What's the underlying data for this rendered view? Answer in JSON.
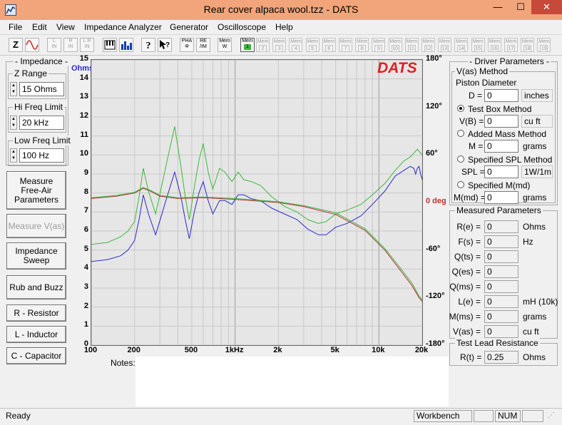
{
  "window": {
    "title": "Rear cover alpaca wool.tzz - DATS",
    "min": "—",
    "max": "☐",
    "close": "✕"
  },
  "menu": [
    "File",
    "Edit",
    "View",
    "Impedance Analyzer",
    "Generator",
    "Oscilloscope",
    "Help"
  ],
  "toolbar": {
    "z": "Z",
    "l_in": [
      "L",
      "IN"
    ],
    "r_in": [
      "R",
      "IN"
    ],
    "lr_in": [
      "L R",
      "IN"
    ],
    "pha": [
      "PHA",
      "Φ"
    ],
    "re_im": [
      "RE",
      "/IM"
    ],
    "mem_w": [
      "Mem",
      "W"
    ],
    "mem1": [
      "Mem",
      "1"
    ],
    "mem_slots": [
      "2",
      "3",
      "4",
      "5",
      "6",
      "7",
      "8",
      "9",
      "10",
      "11",
      "12",
      "13",
      "14",
      "15",
      "16",
      "17",
      "18",
      "19"
    ],
    "mem_label": "Mem"
  },
  "left": {
    "impedance_group": "Impedance",
    "z_range_label": "Z Range",
    "z_range_value": "15 Ohms",
    "hi_freq_label": "Hi Freq Limit",
    "hi_freq_value": "20 kHz",
    "low_freq_label": "Low Freq Limit",
    "low_freq_value": "100 Hz",
    "btn_measure_free_air": "Measure Free-Air Parameters",
    "btn_measure_vas": "Measure V(as)",
    "btn_impedance_sweep": "Impedance Sweep",
    "btn_rub_buzz": "Rub and Buzz",
    "btn_r": "R - Resistor",
    "btn_l": "L - Inductor",
    "btn_c": "C - Capacitor"
  },
  "graph": {
    "logo": "DATS",
    "y_unit": "Ohms",
    "y_ticks": [
      "15",
      "14",
      "13",
      "12",
      "11",
      "10",
      "9",
      "8",
      "7",
      "6",
      "5",
      "4",
      "3",
      "2",
      "1",
      "0"
    ],
    "phase_ticks": [
      "180°",
      "120°",
      "60°",
      "0 deg",
      "-60°",
      "-120°",
      "-180°"
    ],
    "x_ticks": [
      "100",
      "200",
      "500",
      "1kHz",
      "2k",
      "5k",
      "10k",
      "20k"
    ],
    "notes_label": "Notes:",
    "colors": {
      "impedance": "#2a2ad0",
      "impedance_mem": "#3cb83c",
      "phase": "#b03030",
      "phase_mem": "#3cb83c"
    }
  },
  "chart_data": {
    "type": "line",
    "xscale": "log",
    "xlim": [
      100,
      20000
    ],
    "ylim": [
      0,
      15
    ],
    "y2lim": [
      -180,
      180
    ],
    "ylabel": "Ohms",
    "series": [
      {
        "axis": "left",
        "color": "#2a2ad0",
        "x": [
          100,
          130,
          160,
          180,
          200,
          215,
          230,
          250,
          280,
          330,
          380,
          420,
          450,
          480,
          520,
          560,
          600,
          650,
          700,
          780,
          850,
          950,
          1050,
          1150,
          1300,
          1500,
          1800,
          2200,
          2700,
          3200,
          3800,
          4300,
          5000,
          6000,
          7500,
          9000,
          11000,
          13000,
          15000,
          16500,
          17500,
          18000,
          18500,
          19000,
          19500,
          20000
        ],
        "y": [
          4.4,
          4.5,
          4.7,
          5.0,
          5.5,
          6.6,
          7.9,
          6.9,
          5.8,
          7.6,
          9.1,
          7.8,
          6.6,
          5.6,
          7.0,
          8.0,
          8.6,
          7.6,
          6.9,
          7.6,
          7.6,
          7.4,
          7.9,
          7.9,
          7.7,
          7.6,
          7.2,
          6.9,
          6.6,
          6.1,
          5.8,
          5.8,
          6.2,
          6.4,
          6.8,
          7.4,
          8.1,
          8.9,
          9.2,
          9.4,
          9.3,
          9.0,
          9.3,
          9.4,
          9.0,
          8.7
        ]
      },
      {
        "axis": "left",
        "color": "#3cb83c",
        "x": [
          100,
          130,
          160,
          180,
          200,
          215,
          230,
          250,
          280,
          330,
          380,
          420,
          450,
          480,
          520,
          560,
          600,
          650,
          700,
          780,
          850,
          950,
          1050,
          1150,
          1300,
          1500,
          1800,
          2200,
          2700,
          3200,
          3800,
          4300,
          5000,
          6000,
          7500,
          9000,
          11000,
          13000,
          15000,
          16500,
          17500,
          18000,
          18500,
          19000,
          19500,
          20000
        ],
        "y": [
          5.3,
          5.4,
          5.7,
          6.0,
          6.5,
          7.8,
          9.3,
          8.1,
          6.9,
          9.4,
          11.5,
          9.4,
          7.8,
          6.6,
          8.3,
          9.7,
          10.6,
          9.1,
          8.2,
          9.3,
          9.1,
          8.6,
          9.1,
          8.7,
          8.6,
          8.4,
          7.8,
          7.3,
          7.0,
          6.6,
          6.4,
          6.5,
          6.9,
          7.1,
          7.4,
          7.9,
          8.5,
          9.2,
          9.7,
          9.9,
          10.1,
          10.2,
          10.3,
          10.2,
          10.1,
          10.0
        ]
      },
      {
        "axis": "right",
        "color": "#b03030",
        "x": [
          100,
          150,
          200,
          230,
          260,
          300,
          400,
          600,
          1000,
          2000,
          3000,
          5000,
          8000,
          11000,
          14000,
          17000,
          19000,
          20000
        ],
        "y": [
          5,
          8,
          12,
          18,
          14,
          8,
          5,
          6,
          4,
          0,
          -5,
          -15,
          -35,
          -60,
          -85,
          -105,
          -120,
          -125
        ]
      },
      {
        "axis": "right",
        "color": "#3cb83c",
        "x": [
          100,
          150,
          200,
          230,
          260,
          300,
          400,
          600,
          1000,
          2000,
          3000,
          5000,
          8000,
          11000,
          14000,
          17000,
          19000,
          20000
        ],
        "y": [
          6,
          9,
          13,
          19,
          15,
          9,
          6,
          7,
          5,
          1,
          -4,
          -13,
          -33,
          -58,
          -82,
          -102,
          -118,
          -123
        ]
      }
    ]
  },
  "right": {
    "driver_group": "Driver Parameters",
    "vas_method_group": "V(as) Method",
    "piston_label": "Piston Diameter",
    "d_label": "D =",
    "d_value": "0",
    "d_unit": "inches",
    "test_box": "Test Box Method",
    "vb_label": "V(B) =",
    "vb_value": "0",
    "vb_unit": "cu ft",
    "added_mass": "Added Mass Method",
    "m_label": "M =",
    "m_value": "0",
    "m_unit": "grams",
    "spl_method": "Specified SPL Method",
    "spl_label": "SPL =",
    "spl_value": "0",
    "spl_unit": "1W/1m",
    "mmd_method": "Specified M(md)",
    "mmd_label": "M(md) =",
    "mmd_value": "0",
    "mmd_unit": "grams",
    "measured_group": "Measured Parameters",
    "measured": [
      {
        "label": "R(e) =",
        "value": "0",
        "unit": "Ohms"
      },
      {
        "label": "F(s) =",
        "value": "0",
        "unit": "Hz"
      },
      {
        "label": "Q(ts) =",
        "value": "0",
        "unit": ""
      },
      {
        "label": "Q(es) =",
        "value": "0",
        "unit": ""
      },
      {
        "label": "Q(ms) =",
        "value": "0",
        "unit": ""
      },
      {
        "label": "L(e) =",
        "value": "0",
        "unit": "mH (10k)"
      },
      {
        "label": "M(ms) =",
        "value": "0",
        "unit": "grams"
      },
      {
        "label": "V(as) =",
        "value": "0",
        "unit": "cu ft"
      }
    ],
    "lead_group": "Test Lead Resistance",
    "rt_label": "R(t) =",
    "rt_value": "0.25",
    "rt_unit": "Ohms"
  },
  "status": {
    "ready": "Ready",
    "workbench": "Workbench",
    "num": "NUM"
  }
}
